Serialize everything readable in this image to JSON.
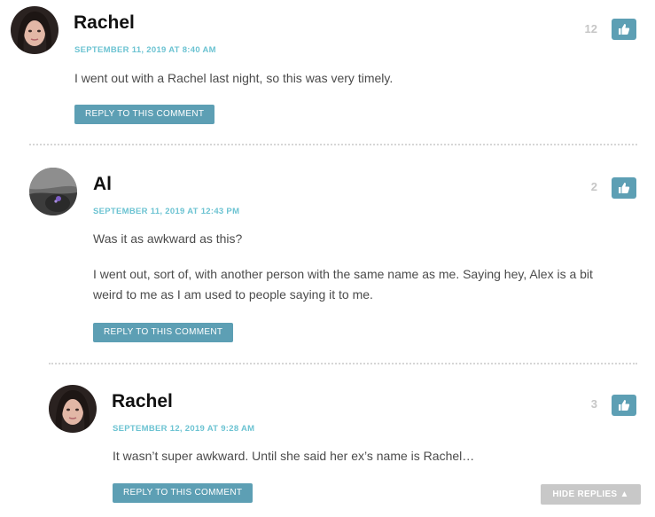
{
  "comments": [
    {
      "author": "Rachel",
      "date": "SEPTEMBER 11, 2019 AT 8:40 AM",
      "paragraphs": [
        "I went out with a Rachel last night, so this was very timely."
      ],
      "reply_label": "REPLY TO THIS COMMENT",
      "votes": "12",
      "avatar_icon": "avatar-dark-hair-woman"
    },
    {
      "author": "Al",
      "date": "SEPTEMBER 11, 2019 AT 12:43 PM",
      "paragraphs": [
        "Was it as awkward as this?",
        "I went out, sort of, with another person with the same name as me. Saying hey, Alex is a bit weird to me as I am used to people saying it to me."
      ],
      "reply_label": "REPLY TO THIS COMMENT",
      "votes": "2",
      "avatar_icon": "avatar-grey-photo"
    },
    {
      "author": "Rachel",
      "date": "SEPTEMBER 12, 2019 AT 9:28 AM",
      "paragraphs": [
        "It wasn’t super awkward. Until she said her ex’s name is Rachel…"
      ],
      "reply_label": "REPLY TO THIS COMMENT",
      "votes": "3",
      "avatar_icon": "avatar-dark-hair-woman"
    }
  ],
  "hide_replies_label": "HIDE REPLIES ▲",
  "icons": {
    "like": "thumbs-up-icon"
  },
  "colors": {
    "accent": "#5d9fb4",
    "meta": "#6cc3d2",
    "vote_count": "#c6c6c6",
    "hide_button": "#c8c8c8"
  }
}
